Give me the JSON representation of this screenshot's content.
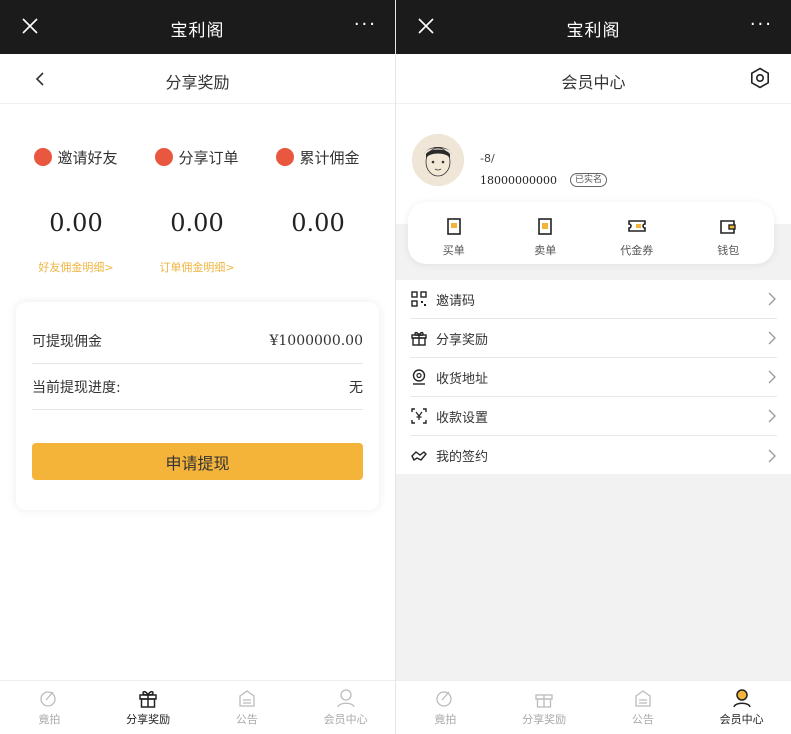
{
  "app_title": "宝利阁",
  "more_glyph": "···",
  "left": {
    "nav_title": "分享奖励",
    "stats": [
      {
        "label": "邀请好友",
        "value": "0.00",
        "link": "好友佣金明细>"
      },
      {
        "label": "分享订单",
        "value": "0.00",
        "link": "订单佣金明细>"
      },
      {
        "label": "累计佣金",
        "value": "0.00",
        "link": ""
      }
    ],
    "card": {
      "withdrawable_label": "可提现佣金",
      "withdrawable_value": "¥1000000.00",
      "progress_label": "当前提现进度:",
      "progress_value": "无",
      "button": "申请提现"
    }
  },
  "right": {
    "nav_title": "会员中心",
    "user": {
      "name": "-8/",
      "phone": "18000000000",
      "badge": "已实名"
    },
    "shortcuts": [
      {
        "label": "买单",
        "icon": "receipt-icon"
      },
      {
        "label": "卖单",
        "icon": "sell-receipt-icon"
      },
      {
        "label": "代金券",
        "icon": "voucher-icon"
      },
      {
        "label": "钱包",
        "icon": "wallet-icon"
      }
    ],
    "menu": [
      {
        "label": "邀请码",
        "icon": "qr-code-icon"
      },
      {
        "label": "分享奖励",
        "icon": "gift-icon"
      },
      {
        "label": "收货地址",
        "icon": "location-icon"
      },
      {
        "label": "收款设置",
        "icon": "yuan-scan-icon"
      },
      {
        "label": "我的签约",
        "icon": "contract-hand-icon"
      }
    ]
  },
  "tabbar": [
    "竟拍",
    "分享奖励",
    "公告",
    "会员中心"
  ],
  "colors": {
    "accent": "#f4b43a",
    "link": "#f0b543",
    "stat_icon": "#e9573f",
    "topbar": "#1b1b1b"
  }
}
